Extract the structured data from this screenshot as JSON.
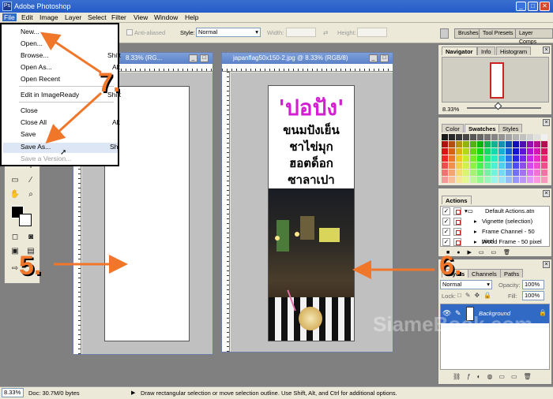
{
  "app": {
    "title": "Adobe Photoshop"
  },
  "menubar": [
    "File",
    "Edit",
    "Image",
    "Layer",
    "Select",
    "Filter",
    "View",
    "Window",
    "Help"
  ],
  "options": {
    "anti_aliased": "Anti-aliased",
    "style_label": "Style:",
    "style_value": "Normal",
    "width_label": "Width:",
    "height_label": "Height:"
  },
  "dock_tabs": [
    "Brushes",
    "Tool Presets",
    "Layer Comps"
  ],
  "file_menu": [
    {
      "label": "New...",
      "shortcut": ""
    },
    {
      "label": "Open...",
      "shortcut": ""
    },
    {
      "label": "Browse...",
      "shortcut": "Shift"
    },
    {
      "label": "Open As...",
      "shortcut": "Alt"
    },
    {
      "label": "Open Recent",
      "shortcut": ""
    },
    {
      "label": "Edit in ImageReady",
      "shortcut": "Shift"
    },
    {
      "label": "Close",
      "shortcut": ""
    },
    {
      "label": "Close All",
      "shortcut": "Alt"
    },
    {
      "label": "Save",
      "shortcut": ""
    },
    {
      "label": "Save As...",
      "shortcut": "Shi"
    },
    {
      "label": "Save a Version...",
      "shortcut": ""
    }
  ],
  "doc1": {
    "title": "8.33% (RG...",
    "zoom": "8.33%"
  },
  "doc2": {
    "title": "japanflag50x150-2.jpg @ 8.33% (RGB/8)",
    "poster_title": "'ปอปัง'",
    "poster_lines": [
      "ขนมปังเย็น",
      "ชาไข่มุก",
      "ฮอตด็อก",
      "ซาลาเปา"
    ]
  },
  "navigator": {
    "tabs": [
      "Navigator",
      "Info",
      "Histogram"
    ],
    "zoom": "8.33%"
  },
  "color_panel": {
    "tabs": [
      "Color",
      "Swatches",
      "Styles"
    ]
  },
  "actions_panel": {
    "tab": "Actions",
    "items": [
      "Default Actions.atn",
      "Vignette (selection)",
      "Frame Channel - 50 pixel",
      "Wood Frame - 50 pixel"
    ]
  },
  "layers_panel": {
    "tabs": [
      "Layers",
      "Channels",
      "Paths"
    ],
    "blend_mode": "Normal",
    "opacity_label": "Opacity:",
    "opacity": "100%",
    "lock_label": "Lock:",
    "fill_label": "Fill:",
    "fill": "100%",
    "layer_name": "Background"
  },
  "status": {
    "zoom": "8.33%",
    "doc": "Doc: 30.7M/0 bytes",
    "hint": "Draw rectangular selection or move selection outline.  Use Shift, Alt, and Ctrl for additional options."
  },
  "annotations": [
    "5.",
    "6.",
    "7."
  ],
  "watermark": "SiameBook.com",
  "colors": {
    "arrow": "#f0762a",
    "accent_magenta": "#d21fd2",
    "selection_blue": "#316ac5"
  }
}
